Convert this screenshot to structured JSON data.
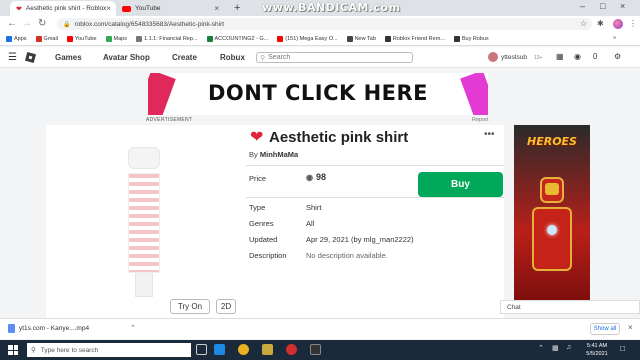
{
  "browser": {
    "tabs": [
      {
        "title": "Aesthetic pink shirt - Roblox",
        "active": true
      },
      {
        "title": "YouTube",
        "active": false
      }
    ],
    "watermark": "www.BANDICAM.com",
    "url": "roblox.com/catalog/6548335683/Aesthetic-pink-shirt",
    "bookmarks": [
      {
        "label": "Apps",
        "color": "#1a73e8"
      },
      {
        "label": "Gmail",
        "color": "#d93025"
      },
      {
        "label": "YouTube",
        "color": "#ff0000"
      },
      {
        "label": "Maps",
        "color": "#34a853"
      },
      {
        "label": "1.1.1: Financial Rep...",
        "color": "#777777"
      },
      {
        "label": "ACCOUNTING2 - G...",
        "color": "#188038"
      },
      {
        "label": "(151) Mega Easy O...",
        "color": "#ff0000"
      },
      {
        "label": "New Tab",
        "color": "#444444"
      },
      {
        "label": "Roblox Friend Rem...",
        "color": "#333333"
      },
      {
        "label": "Buy Robux",
        "color": "#333333"
      }
    ],
    "bookmarks_more": "»"
  },
  "nav": {
    "links": [
      "Games",
      "Avatar Shop",
      "Create",
      "Robux"
    ],
    "search_placeholder": "Search",
    "username": "yttestsub",
    "age": "13+",
    "robux_count": "0"
  },
  "ad": {
    "text": "DONT CLICK HERE",
    "label": "ADVERTISEMENT",
    "report": "Report"
  },
  "item": {
    "title": "Aesthetic pink shirt",
    "by_prefix": "By",
    "creator": "MinhMaMa",
    "price_label": "Price",
    "price": "98",
    "buy_label": "Buy",
    "type_label": "Type",
    "type": "Shirt",
    "genres_label": "Genres",
    "genres": "All",
    "updated_label": "Updated",
    "updated": "Apr 29, 2021 (by mlg_man2222)",
    "description_label": "Description",
    "description": "No description available.",
    "try_on_label": "Try On",
    "view_2d_label": "2D"
  },
  "side_ad": {
    "title": "HEROES"
  },
  "chat": {
    "label": "Chat"
  },
  "downloads": {
    "file": "yt1s.com - Kanye....mp4",
    "show_all": "Show all"
  },
  "taskbar": {
    "search_placeholder": "Type here to search",
    "time": "5:41 AM",
    "date": "5/5/2021"
  },
  "colors": {
    "buy_button": "#00a85a",
    "heart": "#e0263c",
    "taskbar": "#1b2a3a"
  }
}
